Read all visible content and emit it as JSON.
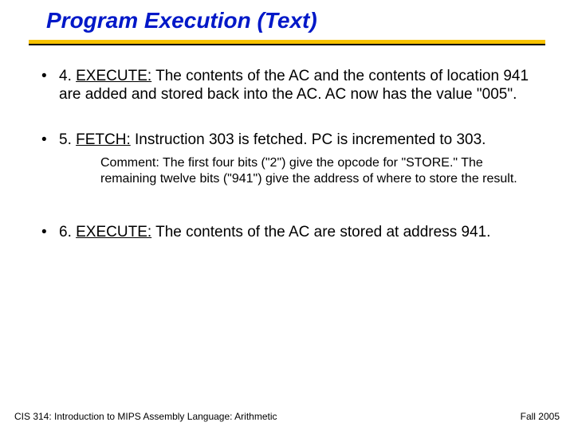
{
  "title": "Program Execution (Text)",
  "bullets": {
    "b1_num": "4. ",
    "b1_heading": "EXECUTE:",
    "b1_rest": " The contents of the AC and the contents of location 941 are added and stored back into the AC. AC now has the value \"005\".",
    "b2_num": "5. ",
    "b2_heading": "FETCH:",
    "b2_rest": " Instruction 303 is fetched.  PC is incremented to 303.",
    "b3_num": "6. ",
    "b3_heading": "EXECUTE:",
    "b3_rest": " The contents of the AC are stored at address 941."
  },
  "comment": "Comment: The first four bits (\"2\") give the opcode for \"STORE.\" The remaining twelve bits (\"941\") give the address of where to store the result.",
  "footer": {
    "left": "CIS 314:  Introduction to MIPS Assembly Language:  Arithmetic",
    "right": "Fall 2005"
  },
  "glyphs": {
    "bullet": "•"
  }
}
